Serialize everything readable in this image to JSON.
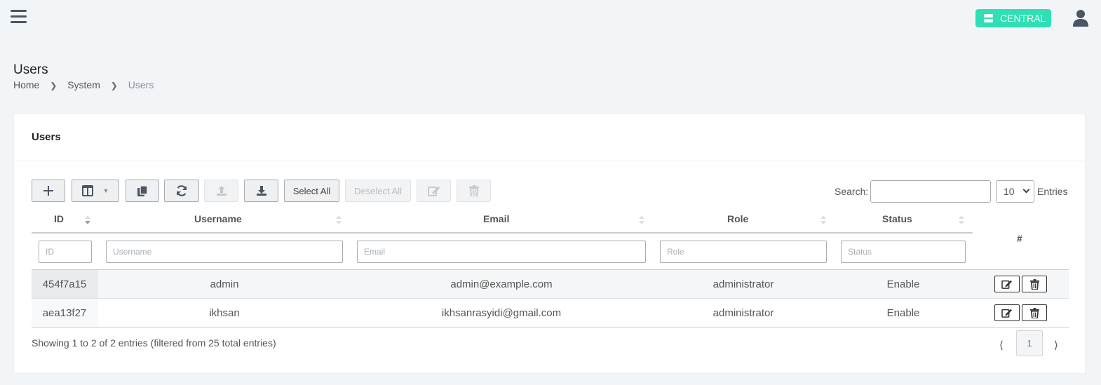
{
  "header": {
    "central_label": "CENTRAL"
  },
  "page": {
    "title": "Users",
    "breadcrumb": [
      "Home",
      "System",
      "Users"
    ]
  },
  "card": {
    "title": "Users"
  },
  "toolbar": {
    "select_all_label": "Select All",
    "deselect_all_label": "Deselect All",
    "search_label": "Search:",
    "search_value": "",
    "length_value": "10",
    "entries_label": "Entries"
  },
  "table": {
    "columns": [
      "ID",
      "Username",
      "Email",
      "Role",
      "Status"
    ],
    "actions_header": "#",
    "filter_placeholders": [
      "ID",
      "Username",
      "Email",
      "Role",
      "Status"
    ],
    "sort": {
      "column": "ID",
      "direction": "desc"
    },
    "rows": [
      {
        "id": "454f7a15",
        "username": "admin",
        "email": "admin@example.com",
        "role": "administrator",
        "status": "Enable"
      },
      {
        "id": "aea13f27",
        "username": "ikhsan",
        "email": "ikhsanrasyidi@gmail.com",
        "role": "administrator",
        "status": "Enable"
      }
    ]
  },
  "footer": {
    "info": "Showing 1 to 2 of 2 entries (filtered from 25 total entries)",
    "prev": "⟨",
    "next": "⟩",
    "page": "1"
  },
  "colors": {
    "accent": "#2ee0b3",
    "background": "#f2f5f8"
  }
}
